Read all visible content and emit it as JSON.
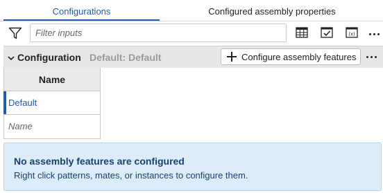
{
  "tabs": [
    {
      "label": "Configurations",
      "active": true
    },
    {
      "label": "Configured assembly properties",
      "active": false
    }
  ],
  "filter": {
    "placeholder": "Filter inputs",
    "value": ""
  },
  "toolbar": {
    "icons": [
      "filter-icon",
      "table-icon",
      "checkbox-icon",
      "variable-icon",
      "more-icon"
    ]
  },
  "configuration": {
    "title": "Configuration",
    "default_text": "Default: Default",
    "configure_button_label": "Configure assembly features"
  },
  "table": {
    "header": "Name",
    "rows": [
      "Default"
    ],
    "new_row_placeholder": "Name"
  },
  "banner": {
    "title": "No assembly features are configured",
    "text": "Right click patterns, mates, or instances to configure them."
  },
  "colors": {
    "accent": "#1f5ba7",
    "header_bg": "#e6e6e6",
    "banner_bg": "#dcedf9",
    "banner_text": "#1a3f6e"
  }
}
